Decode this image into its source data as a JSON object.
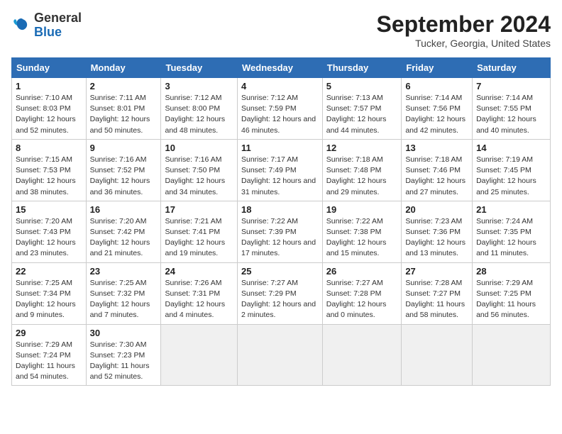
{
  "logo": {
    "general": "General",
    "blue": "Blue"
  },
  "title": "September 2024",
  "location": "Tucker, Georgia, United States",
  "days_of_week": [
    "Sunday",
    "Monday",
    "Tuesday",
    "Wednesday",
    "Thursday",
    "Friday",
    "Saturday"
  ],
  "weeks": [
    [
      {
        "num": "1",
        "sunrise": "7:10 AM",
        "sunset": "8:03 PM",
        "daylight": "12 hours and 52 minutes."
      },
      {
        "num": "2",
        "sunrise": "7:11 AM",
        "sunset": "8:01 PM",
        "daylight": "12 hours and 50 minutes."
      },
      {
        "num": "3",
        "sunrise": "7:12 AM",
        "sunset": "8:00 PM",
        "daylight": "12 hours and 48 minutes."
      },
      {
        "num": "4",
        "sunrise": "7:12 AM",
        "sunset": "7:59 PM",
        "daylight": "12 hours and 46 minutes."
      },
      {
        "num": "5",
        "sunrise": "7:13 AM",
        "sunset": "7:57 PM",
        "daylight": "12 hours and 44 minutes."
      },
      {
        "num": "6",
        "sunrise": "7:14 AM",
        "sunset": "7:56 PM",
        "daylight": "12 hours and 42 minutes."
      },
      {
        "num": "7",
        "sunrise": "7:14 AM",
        "sunset": "7:55 PM",
        "daylight": "12 hours and 40 minutes."
      }
    ],
    [
      {
        "num": "8",
        "sunrise": "7:15 AM",
        "sunset": "7:53 PM",
        "daylight": "12 hours and 38 minutes."
      },
      {
        "num": "9",
        "sunrise": "7:16 AM",
        "sunset": "7:52 PM",
        "daylight": "12 hours and 36 minutes."
      },
      {
        "num": "10",
        "sunrise": "7:16 AM",
        "sunset": "7:50 PM",
        "daylight": "12 hours and 34 minutes."
      },
      {
        "num": "11",
        "sunrise": "7:17 AM",
        "sunset": "7:49 PM",
        "daylight": "12 hours and 31 minutes."
      },
      {
        "num": "12",
        "sunrise": "7:18 AM",
        "sunset": "7:48 PM",
        "daylight": "12 hours and 29 minutes."
      },
      {
        "num": "13",
        "sunrise": "7:18 AM",
        "sunset": "7:46 PM",
        "daylight": "12 hours and 27 minutes."
      },
      {
        "num": "14",
        "sunrise": "7:19 AM",
        "sunset": "7:45 PM",
        "daylight": "12 hours and 25 minutes."
      }
    ],
    [
      {
        "num": "15",
        "sunrise": "7:20 AM",
        "sunset": "7:43 PM",
        "daylight": "12 hours and 23 minutes."
      },
      {
        "num": "16",
        "sunrise": "7:20 AM",
        "sunset": "7:42 PM",
        "daylight": "12 hours and 21 minutes."
      },
      {
        "num": "17",
        "sunrise": "7:21 AM",
        "sunset": "7:41 PM",
        "daylight": "12 hours and 19 minutes."
      },
      {
        "num": "18",
        "sunrise": "7:22 AM",
        "sunset": "7:39 PM",
        "daylight": "12 hours and 17 minutes."
      },
      {
        "num": "19",
        "sunrise": "7:22 AM",
        "sunset": "7:38 PM",
        "daylight": "12 hours and 15 minutes."
      },
      {
        "num": "20",
        "sunrise": "7:23 AM",
        "sunset": "7:36 PM",
        "daylight": "12 hours and 13 minutes."
      },
      {
        "num": "21",
        "sunrise": "7:24 AM",
        "sunset": "7:35 PM",
        "daylight": "12 hours and 11 minutes."
      }
    ],
    [
      {
        "num": "22",
        "sunrise": "7:25 AM",
        "sunset": "7:34 PM",
        "daylight": "12 hours and 9 minutes."
      },
      {
        "num": "23",
        "sunrise": "7:25 AM",
        "sunset": "7:32 PM",
        "daylight": "12 hours and 7 minutes."
      },
      {
        "num": "24",
        "sunrise": "7:26 AM",
        "sunset": "7:31 PM",
        "daylight": "12 hours and 4 minutes."
      },
      {
        "num": "25",
        "sunrise": "7:27 AM",
        "sunset": "7:29 PM",
        "daylight": "12 hours and 2 minutes."
      },
      {
        "num": "26",
        "sunrise": "7:27 AM",
        "sunset": "7:28 PM",
        "daylight": "12 hours and 0 minutes."
      },
      {
        "num": "27",
        "sunrise": "7:28 AM",
        "sunset": "7:27 PM",
        "daylight": "11 hours and 58 minutes."
      },
      {
        "num": "28",
        "sunrise": "7:29 AM",
        "sunset": "7:25 PM",
        "daylight": "11 hours and 56 minutes."
      }
    ],
    [
      {
        "num": "29",
        "sunrise": "7:29 AM",
        "sunset": "7:24 PM",
        "daylight": "11 hours and 54 minutes."
      },
      {
        "num": "30",
        "sunrise": "7:30 AM",
        "sunset": "7:23 PM",
        "daylight": "11 hours and 52 minutes."
      },
      null,
      null,
      null,
      null,
      null
    ]
  ]
}
